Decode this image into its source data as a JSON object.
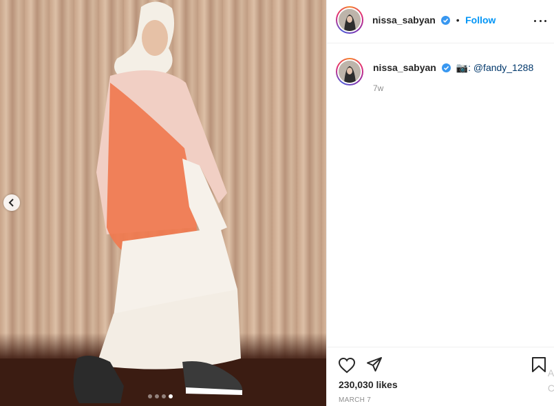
{
  "post": {
    "username": "nissa_sabyan",
    "follow_label": "Follow",
    "separator": "•",
    "caption_emoji": "📷",
    "caption_text": ": @fandy_1288",
    "comment_time": "7w",
    "likes": "230,030 likes",
    "date": "MARCH 7",
    "cutoff_chars": "A\nC"
  },
  "carousel": {
    "total": 4,
    "active_index": 3
  },
  "icons": {
    "more": "more-options-icon",
    "verified": "verified-badge-icon",
    "like": "heart-icon",
    "share": "paper-plane-icon",
    "save": "bookmark-icon",
    "prev": "chevron-left-icon"
  },
  "colors": {
    "accent": "#0095f6",
    "verified": "#3897f0",
    "text": "#262626",
    "muted": "#8e8e8e",
    "mention": "#00376b"
  }
}
